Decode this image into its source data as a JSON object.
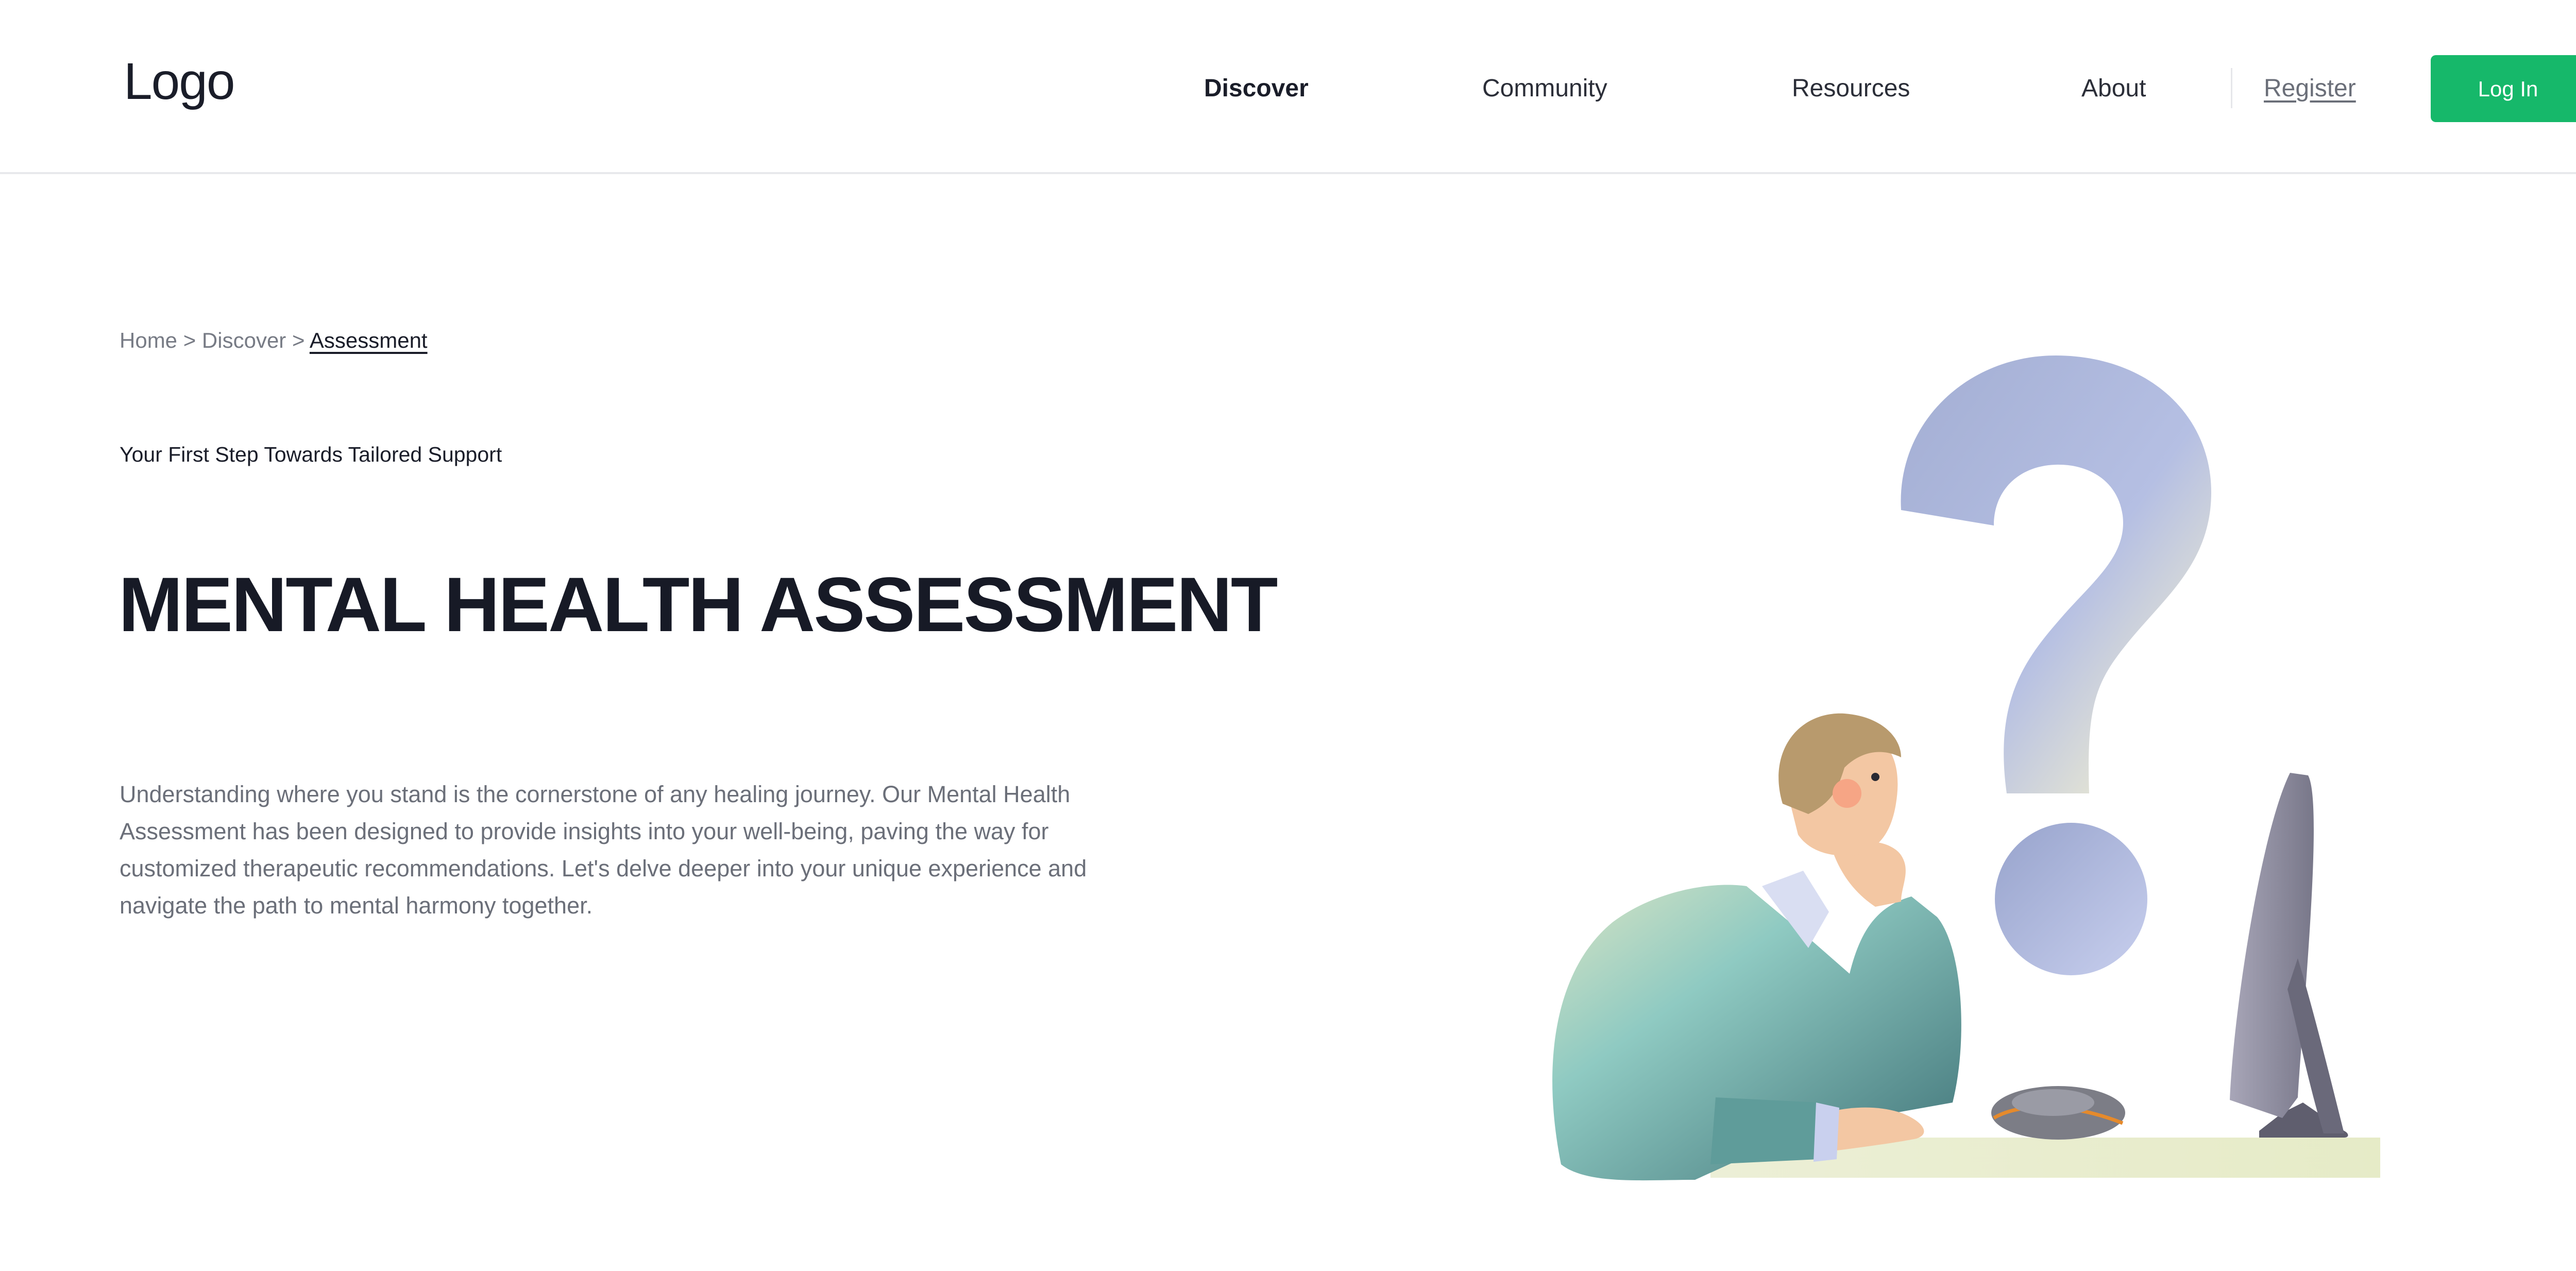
{
  "header": {
    "logo": "Logo",
    "nav": [
      {
        "label": "Discover",
        "active": true
      },
      {
        "label": "Community",
        "active": false
      },
      {
        "label": "Resources",
        "active": false
      },
      {
        "label": "About",
        "active": false
      }
    ],
    "register_label": "Register",
    "login_label": "Log In"
  },
  "breadcrumb": {
    "items": [
      "Home",
      "Discover"
    ],
    "separator": ">",
    "current": "Assessment"
  },
  "hero": {
    "eyebrow": "Your First Step Towards Tailored Support",
    "title": "MENTAL HEALTH ASSESSMENT",
    "description": "Understanding where you stand is the cornerstone of any healing journey. Our Mental Health Assessment has been designed to provide insights into your well-being, paving the way for customized therapeutic recommendations. Let's delve deeper into your unique experience and navigate the path to mental harmony together."
  },
  "illustration": {
    "icon": "person-at-computer-question-mark-illustration"
  },
  "colors": {
    "accent": "#16b86a",
    "text_dark": "#1a1d29",
    "text_muted": "#6b6f79"
  }
}
